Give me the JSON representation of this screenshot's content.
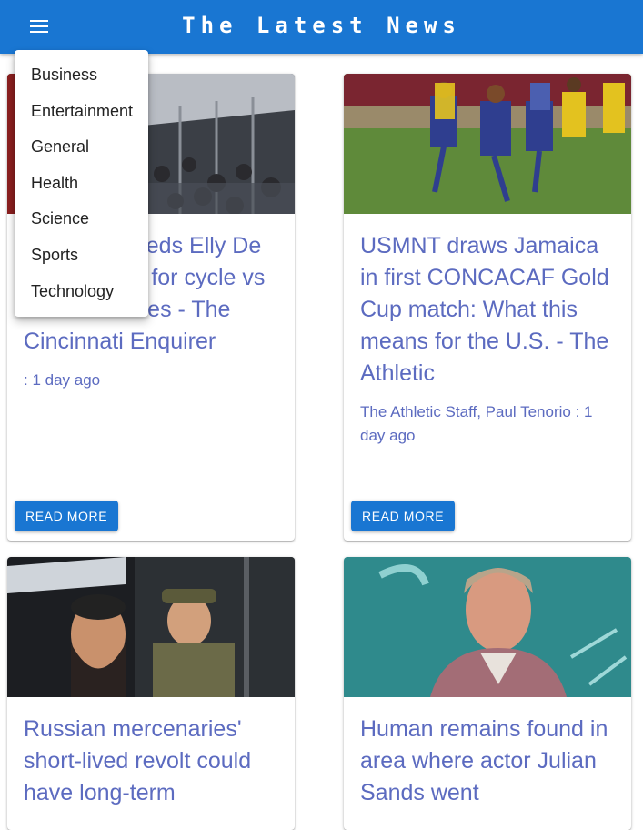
{
  "app": {
    "title": "The Latest News"
  },
  "menu": {
    "items": [
      "Business",
      "Entertainment",
      "General",
      "Health",
      "Science",
      "Sports",
      "Technology"
    ]
  },
  "articles": [
    {
      "headline": "Cincinnati Reds Elly De La Cruz hits for cycle vs Atlanta Braves - The Cincinnati Enquirer",
      "meta": ": 1 day ago",
      "button": "READ MORE"
    },
    {
      "headline": "USMNT draws Jamaica in first CONCACAF Gold Cup match: What this means for the U.S. - The Athletic",
      "meta": "The Athletic Staff, Paul Tenorio : 1 day ago",
      "button": "READ MORE"
    },
    {
      "headline": "Russian mercenaries' short-lived revolt could have long-term",
      "meta": "",
      "button": ""
    },
    {
      "headline": "Human remains found in area where actor Julian Sands went",
      "meta": "",
      "button": ""
    }
  ],
  "colors": {
    "appbar": "#1976d2",
    "headline": "#5c6bc0"
  }
}
